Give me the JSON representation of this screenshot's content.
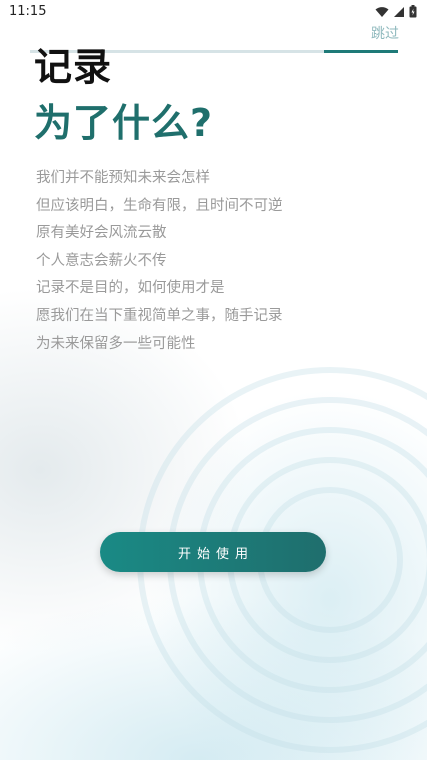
{
  "status_bar": {
    "time": "11:15",
    "icons": [
      "wifi-icon",
      "signal-icon",
      "battery-icon"
    ]
  },
  "progress": {
    "value": 0.2
  },
  "header": {
    "skip_label": "跳过"
  },
  "headline": {
    "line1": "记录",
    "line2": "为了什么?"
  },
  "body_lines": [
    "我们并不能预知未来会怎样",
    "但应该明白，生命有限，且时间不可逆",
    "原有美好会风流云散",
    "个人意志会薪火不传",
    "记录不是目的，如何使用才是",
    "愿我们在当下重视简单之事，随手记录",
    "为未来保留多一些可能性"
  ],
  "actions": {
    "start_label": "开始使用"
  },
  "colors": {
    "accent": "#1f6f6c",
    "skip": "#8fb9bd",
    "body_text": "#9a9a9a",
    "headline_dark": "#111111"
  }
}
